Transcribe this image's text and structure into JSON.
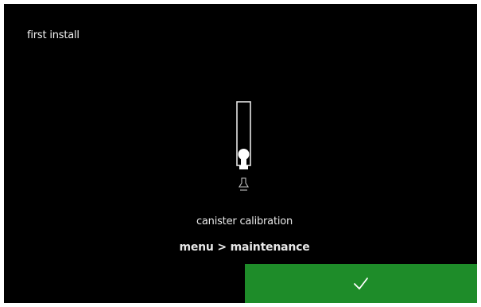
{
  "screen": {
    "title": "first install"
  },
  "instruction": {
    "icon": "canister-calibration-icon",
    "caption": "canister calibration",
    "menu_path": "menu > maintenance"
  },
  "actions": {
    "confirm_icon": "checkmark-icon"
  },
  "colors": {
    "background": "#000000",
    "text": "#f2f2f2",
    "confirm_button": "#1e8c29",
    "frame": "#ffffff"
  }
}
